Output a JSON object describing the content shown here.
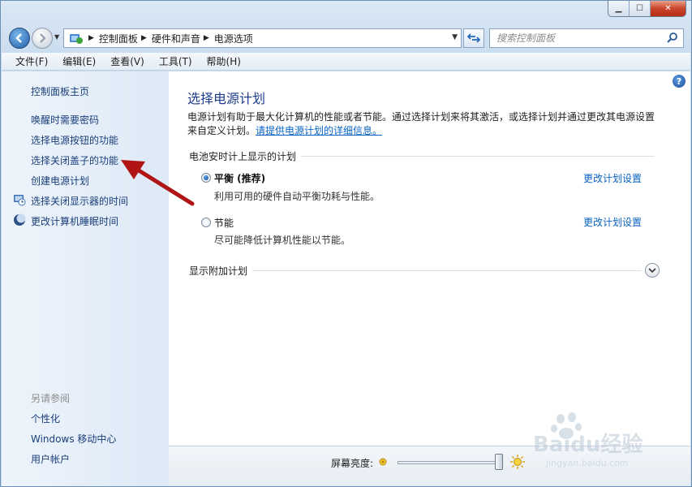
{
  "window": {
    "caption_buttons": [
      "minimize",
      "maximize",
      "close"
    ]
  },
  "address": {
    "breadcrumbs": [
      "控制面板",
      "硬件和声音",
      "电源选项"
    ],
    "search_placeholder": "搜索控制面板"
  },
  "menu": {
    "items": [
      "文件(F)",
      "编辑(E)",
      "查看(V)",
      "工具(T)",
      "帮助(H)"
    ]
  },
  "sidebar": {
    "home": "控制面板主页",
    "links": [
      {
        "label": "唤醒时需要密码",
        "icon": ""
      },
      {
        "label": "选择电源按钮的功能",
        "icon": ""
      },
      {
        "label": "选择关闭盖子的功能",
        "icon": ""
      },
      {
        "label": "创建电源计划",
        "icon": ""
      },
      {
        "label": "选择关闭显示器的时间",
        "icon": "monitor-clock-icon"
      },
      {
        "label": "更改计算机睡眠时间",
        "icon": "moon-icon"
      }
    ],
    "see_also_heading": "另请参阅",
    "see_also": [
      "个性化",
      "Windows 移动中心",
      "用户帐户"
    ]
  },
  "main": {
    "title": "选择电源计划",
    "description": "电源计划有助于最大化计算机的性能或者节能。通过选择计划来将其激活，或选择计划并通过更改其电源设置来自定义计划。",
    "description_link": "请提供电源计划的详细信息。",
    "group_label": "电池安时计上显示的计划",
    "plans": [
      {
        "name": "平衡 (推荐)",
        "desc": "利用可用的硬件自动平衡功耗与性能。",
        "selected": true,
        "link": "更改计划设置"
      },
      {
        "name": "节能",
        "desc": "尽可能降低计算机性能以节能。",
        "selected": false,
        "link": "更改计划设置"
      }
    ],
    "more_plans": "显示附加计划"
  },
  "bottom": {
    "brightness_label": "屏幕亮度:",
    "brightness_fraction": 1.0
  },
  "watermark": {
    "line1": "Baidu经验",
    "line2": "jingyan.baidu.com"
  },
  "colors": {
    "link": "#0a63c4",
    "title": "#1e3c8c",
    "annotation_arrow": "#b01414"
  }
}
